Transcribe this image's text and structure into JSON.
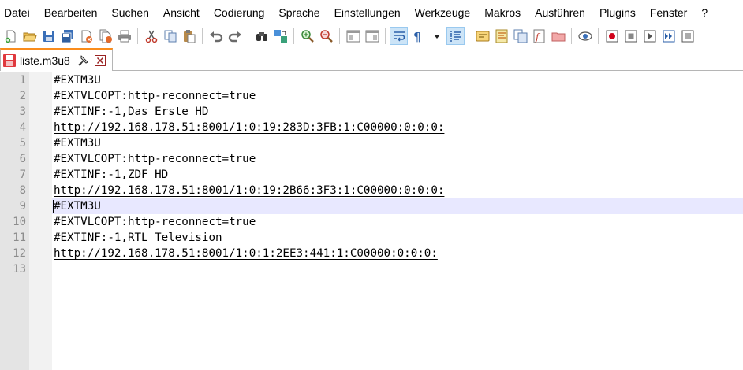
{
  "menu": {
    "items": [
      "Datei",
      "Bearbeiten",
      "Suchen",
      "Ansicht",
      "Codierung",
      "Sprache",
      "Einstellungen",
      "Werkzeuge",
      "Makros",
      "Ausführen",
      "Plugins",
      "Fenster",
      "?"
    ]
  },
  "toolbar": {
    "icons": [
      "new-file-icon",
      "open-file-icon",
      "save-icon",
      "save-all-icon",
      "close-icon",
      "close-all-icon",
      "print-icon",
      "cut-icon",
      "copy-icon",
      "paste-icon",
      "undo-icon",
      "redo-icon",
      "find-icon",
      "replace-icon",
      "zoom-in-icon",
      "zoom-out-icon",
      "sync-vertical-icon",
      "sync-horizontal-icon",
      "word-wrap-icon",
      "show-all-characters-icon",
      "dropdown-icon",
      "indent-guide-icon",
      "user-defined-language-icon",
      "document-map-icon",
      "function-list-icon",
      "folder-as-workspace-icon",
      "document-list-icon",
      "monitoring-icon",
      "record-macro-icon",
      "stop-recording-icon",
      "play-macro-icon",
      "run-macro-multiple-icon",
      "save-macro-icon"
    ]
  },
  "tab": {
    "label": "liste.m3u8",
    "accent_color": "#fa8c1c"
  },
  "editor": {
    "current_line": 9,
    "lines": [
      {
        "number": "1",
        "text": "#EXTM3U"
      },
      {
        "number": "2",
        "text": "#EXTVLCOPT:http-reconnect=true"
      },
      {
        "number": "3",
        "text": "#EXTINF:-1,Das Erste HD"
      },
      {
        "number": "4",
        "text": "http://192.168.178.51:8001/1:0:19:283D:3FB:1:C00000:0:0:0:"
      },
      {
        "number": "5",
        "text": "#EXTM3U"
      },
      {
        "number": "6",
        "text": "#EXTVLCOPT:http-reconnect=true"
      },
      {
        "number": "7",
        "text": "#EXTINF:-1,ZDF HD"
      },
      {
        "number": "8",
        "text": "http://192.168.178.51:8001/1:0:19:2B66:3F3:1:C00000:0:0:0:"
      },
      {
        "number": "9",
        "text": "#EXTM3U"
      },
      {
        "number": "10",
        "text": "#EXTVLCOPT:http-reconnect=true"
      },
      {
        "number": "11",
        "text": "#EXTINF:-1,RTL Television"
      },
      {
        "number": "12",
        "text": "http://192.168.178.51:8001/1:0:1:2EE3:441:1:C00000:0:0:0:"
      },
      {
        "number": "13",
        "text": ""
      }
    ]
  }
}
